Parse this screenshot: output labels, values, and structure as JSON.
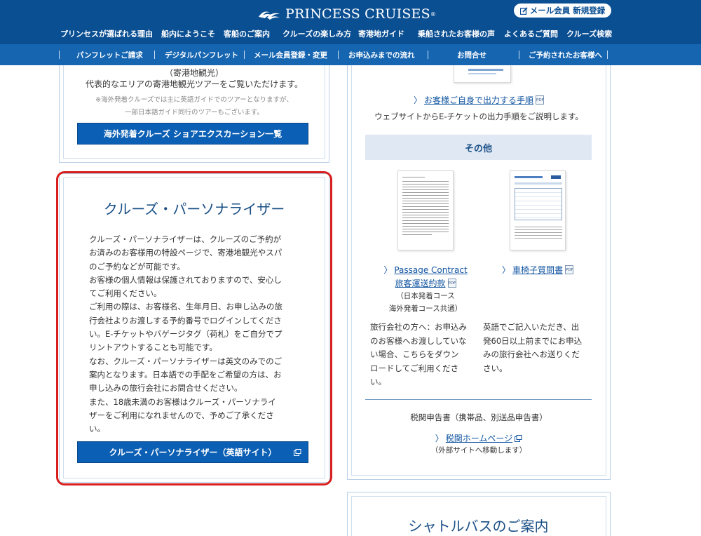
{
  "header": {
    "brand": "PRINCESS CRUISES",
    "registered_mark": "®",
    "member_button": "メール会員 新規登録",
    "main_nav": [
      "プリンセスが選ばれる理由",
      "船内にようこそ",
      "客船のご案内",
      "クルーズの楽しみ方",
      "寄港地ガイド",
      "乗船されたお客様の声",
      "よくあるご質問",
      "クルーズ検索"
    ],
    "sub_nav": [
      "パンフレットご請求",
      "デジタルパンフレット",
      "メール会員登録・変更",
      "お申込みまでの流れ",
      "お問合せ",
      "ご予約されたお客様へ"
    ]
  },
  "left_top": {
    "heading_partial": "（寄港地観光）",
    "desc": "代表的なエリアの寄港地観光ツアーをご覧いただけます。",
    "note_line1": "※海外発着クルーズでは主に英語ガイドでのツアーとなりますが、",
    "note_line2": "一部日本語ガイド同行のツアーもございます。",
    "button": "海外発着クルーズ ショアエクスカーション一覧"
  },
  "personalizer": {
    "title": "クルーズ・パーソナライザー",
    "body_lines": [
      "クルーズ・パーソナライザーは、クルーズのご予約が",
      "お済みのお客様用の特設ページで、寄港地観光やスパ",
      "のご予約などが可能です。",
      "お客様の個人情報は保護されておりますので、安心し",
      "てご利用ください。",
      "ご利用の際は、お客様名、生年月日、お申し込みの旅",
      "行会社よりお渡しする予約番号でログインしてくださ",
      "い。E-チケットやバゲージタグ（荷札）をご自分でプ",
      "リントアウトすることも可能です。",
      "なお、クルーズ・パーソナライザーは英文のみでのご",
      "案内となります。日本語での手配をご希望の方は、お",
      "申し込みの旅行会社にお問合せください。",
      "また、18歳未満のお客様はクルーズ・パーソナライ",
      "ザーをご利用になれませんので、予めご了承くださ",
      "い。"
    ],
    "button": "クルーズ・パーソナライザー（英語サイト）"
  },
  "right": {
    "eticket_link": "お客様ご自身で出力する手順",
    "eticket_desc": "ウェブサイトからE-チケットの出力手順をご説明します。",
    "pdf_label": "PDF",
    "other_heading": "その他",
    "passage_link_en": "Passage Contract",
    "passage_link_ja": "旅客運送約款",
    "passage_note_1": "（日本発着コース",
    "passage_note_2": "海外発着コース共通）",
    "wheelchair_link": "車椅子質問書",
    "passage_desc_lines": [
      "旅行会社の方へ：お申込み",
      "のお客様へお渡ししていな",
      "い場合、こちらをダウン",
      "ロードしてご利用くださ",
      "い。"
    ],
    "wheelchair_desc_lines": [
      "英語でご記入いただき、出",
      "発60日以上前までにお申込",
      "みの旅行会社へお送りくだ",
      "さい。"
    ],
    "customs_text": "税関申告書（携帯品、別送品申告書）",
    "customs_link": "税関ホームページ",
    "customs_note": "（外部サイトへ移動します）"
  },
  "shuttle": {
    "title": "シャトルバスのご案内"
  },
  "colors": {
    "header_dark": "#0b4f93",
    "header_sub": "#1565b1",
    "button_blue": "#0b5fb4",
    "highlight_red": "#d81e1e",
    "title_blue": "#1a4f86"
  }
}
